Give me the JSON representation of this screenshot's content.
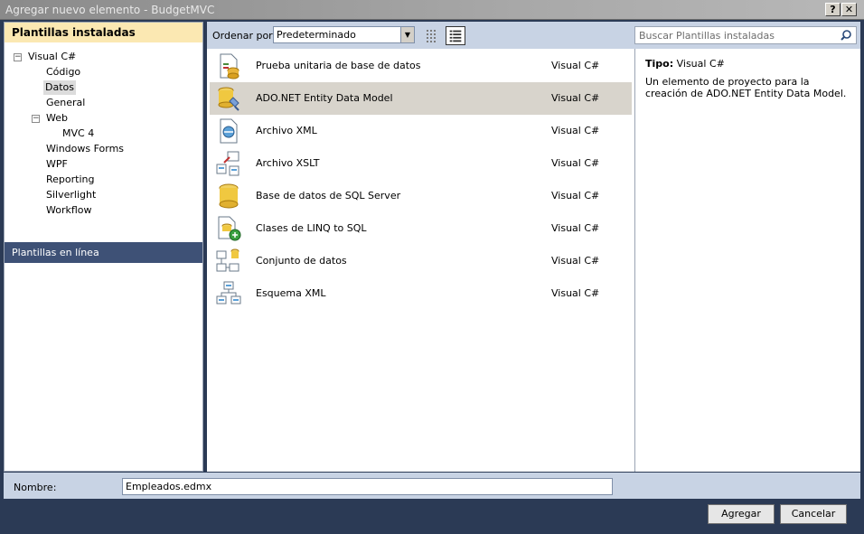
{
  "window": {
    "title": "Agregar nuevo elemento - BudgetMVC",
    "help_label": "?",
    "close_label": "✕"
  },
  "sidebar": {
    "header": "Plantillas instaladas",
    "tree": {
      "visual_csharp": "Visual C#",
      "codigo": "Código",
      "datos": "Datos",
      "general": "General",
      "web": "Web",
      "mvc4": "MVC 4",
      "windows_forms": "Windows Forms",
      "wpf": "WPF",
      "reporting": "Reporting",
      "silverlight": "Silverlight",
      "workflow": "Workflow"
    },
    "online": "Plantillas en línea"
  },
  "toolbar": {
    "sort_label": "Ordenar por:",
    "sort_value": "Predeterminado"
  },
  "templates": [
    {
      "name": "Prueba unitaria de base de datos",
      "lang": "Visual C#",
      "icon": "unit-test-icon"
    },
    {
      "name": "ADO.NET Entity Data Model",
      "lang": "Visual C#",
      "icon": "entity-model-icon",
      "selected": true
    },
    {
      "name": "Archivo XML",
      "lang": "Visual C#",
      "icon": "xml-file-icon"
    },
    {
      "name": "Archivo XSLT",
      "lang": "Visual C#",
      "icon": "xslt-file-icon"
    },
    {
      "name": "Base de datos de SQL Server",
      "lang": "Visual C#",
      "icon": "database-icon"
    },
    {
      "name": "Clases de LINQ to SQL",
      "lang": "Visual C#",
      "icon": "linq-icon"
    },
    {
      "name": "Conjunto de datos",
      "lang": "Visual C#",
      "icon": "dataset-icon"
    },
    {
      "name": "Esquema XML",
      "lang": "Visual C#",
      "icon": "xml-schema-icon"
    }
  ],
  "search": {
    "placeholder": "Buscar Plantillas instaladas"
  },
  "description": {
    "type_label": "Tipo:",
    "type_value": "Visual C#",
    "text": "Un elemento de proyecto para la creación de ADO.NET Entity Data Model."
  },
  "name_row": {
    "label": "Nombre:",
    "value": "Empleados.edmx"
  },
  "buttons": {
    "add": "Agregar",
    "cancel": "Cancelar"
  }
}
